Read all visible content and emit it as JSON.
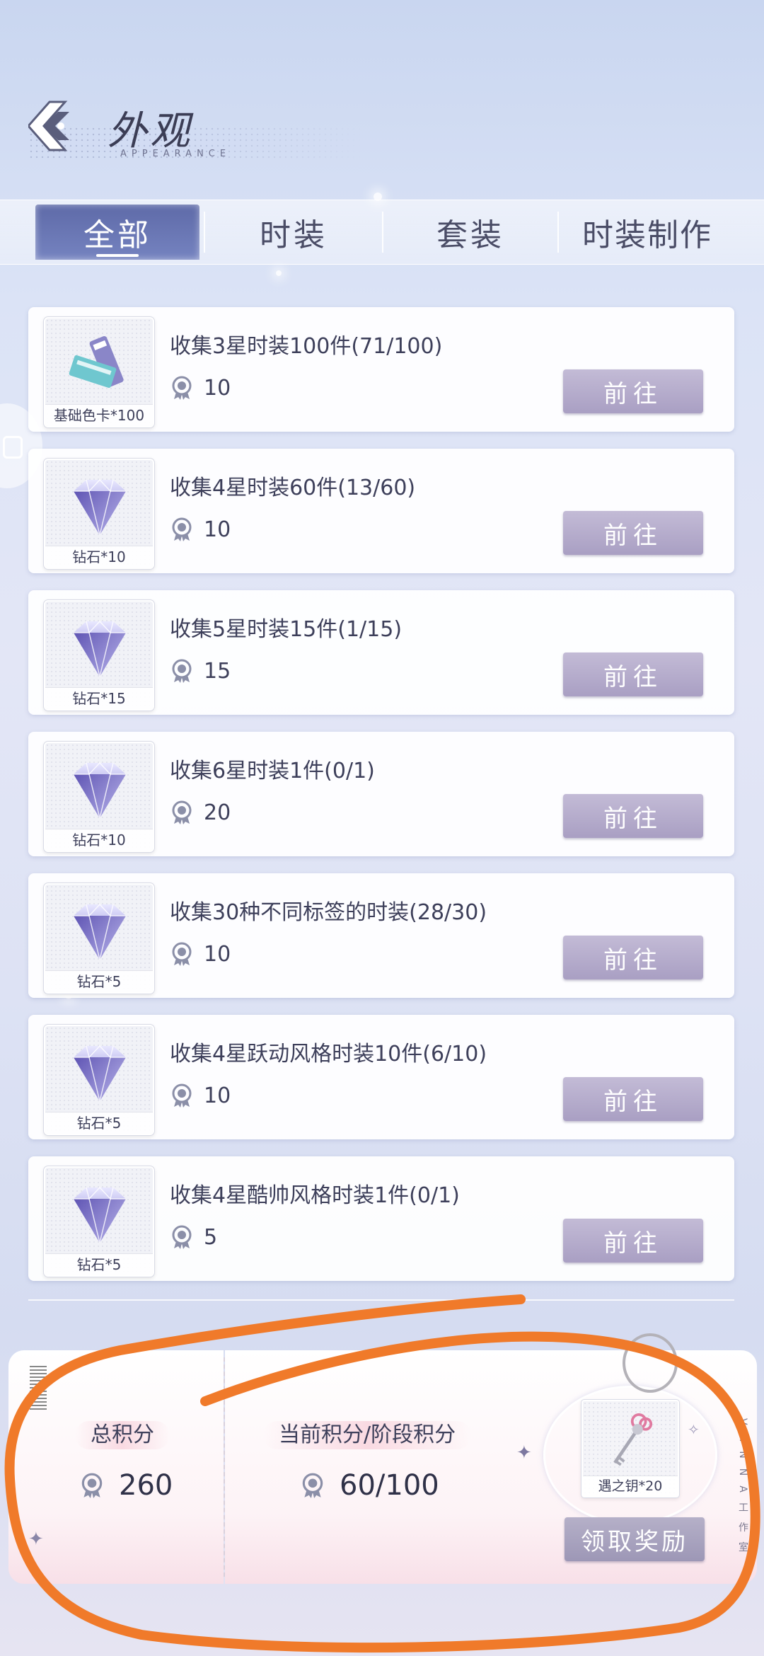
{
  "header": {
    "title": "外观",
    "subtitle": "APPEARANCE"
  },
  "tabs": [
    {
      "label": "全部",
      "active": true
    },
    {
      "label": "时装",
      "active": false
    },
    {
      "label": "套装",
      "active": false
    },
    {
      "label": "时装制作",
      "active": false
    }
  ],
  "tasks": [
    {
      "title": "收集3星时装100件(71/100)",
      "points": "10",
      "reward": "基础色卡*100",
      "reward_icon": "color-card-icon",
      "button": "前往"
    },
    {
      "title": "收集4星时装60件(13/60)",
      "points": "10",
      "reward": "钻石*10",
      "reward_icon": "diamond-icon",
      "button": "前往"
    },
    {
      "title": "收集5星时装15件(1/15)",
      "points": "15",
      "reward": "钻石*15",
      "reward_icon": "diamond-icon",
      "button": "前往"
    },
    {
      "title": "收集6星时装1件(0/1)",
      "points": "20",
      "reward": "钻石*10",
      "reward_icon": "diamond-icon",
      "button": "前往"
    },
    {
      "title": "收集30种不同标签的时装(28/30)",
      "points": "10",
      "reward": "钻石*5",
      "reward_icon": "diamond-icon",
      "button": "前往"
    },
    {
      "title": "收集4星跃动风格时装10件(6/10)",
      "points": "10",
      "reward": "钻石*5",
      "reward_icon": "diamond-icon",
      "button": "前往"
    },
    {
      "title": "收集4星酷帅风格时装1件(0/1)",
      "points": "5",
      "reward": "钻石*5",
      "reward_icon": "diamond-icon",
      "button": "前往"
    }
  ],
  "summary": {
    "total_label": "总积分",
    "total_value": "260",
    "current_label": "当前积分/阶段积分",
    "current_value": "60/100",
    "stage_reward": "遇之钥*20",
    "claim_button": "领取奖励",
    "side_text": "VANNA工作室"
  },
  "colors": {
    "accent_tab": "#6470b0",
    "button": "#b0a8c8",
    "annotation": "#f07a2a"
  }
}
